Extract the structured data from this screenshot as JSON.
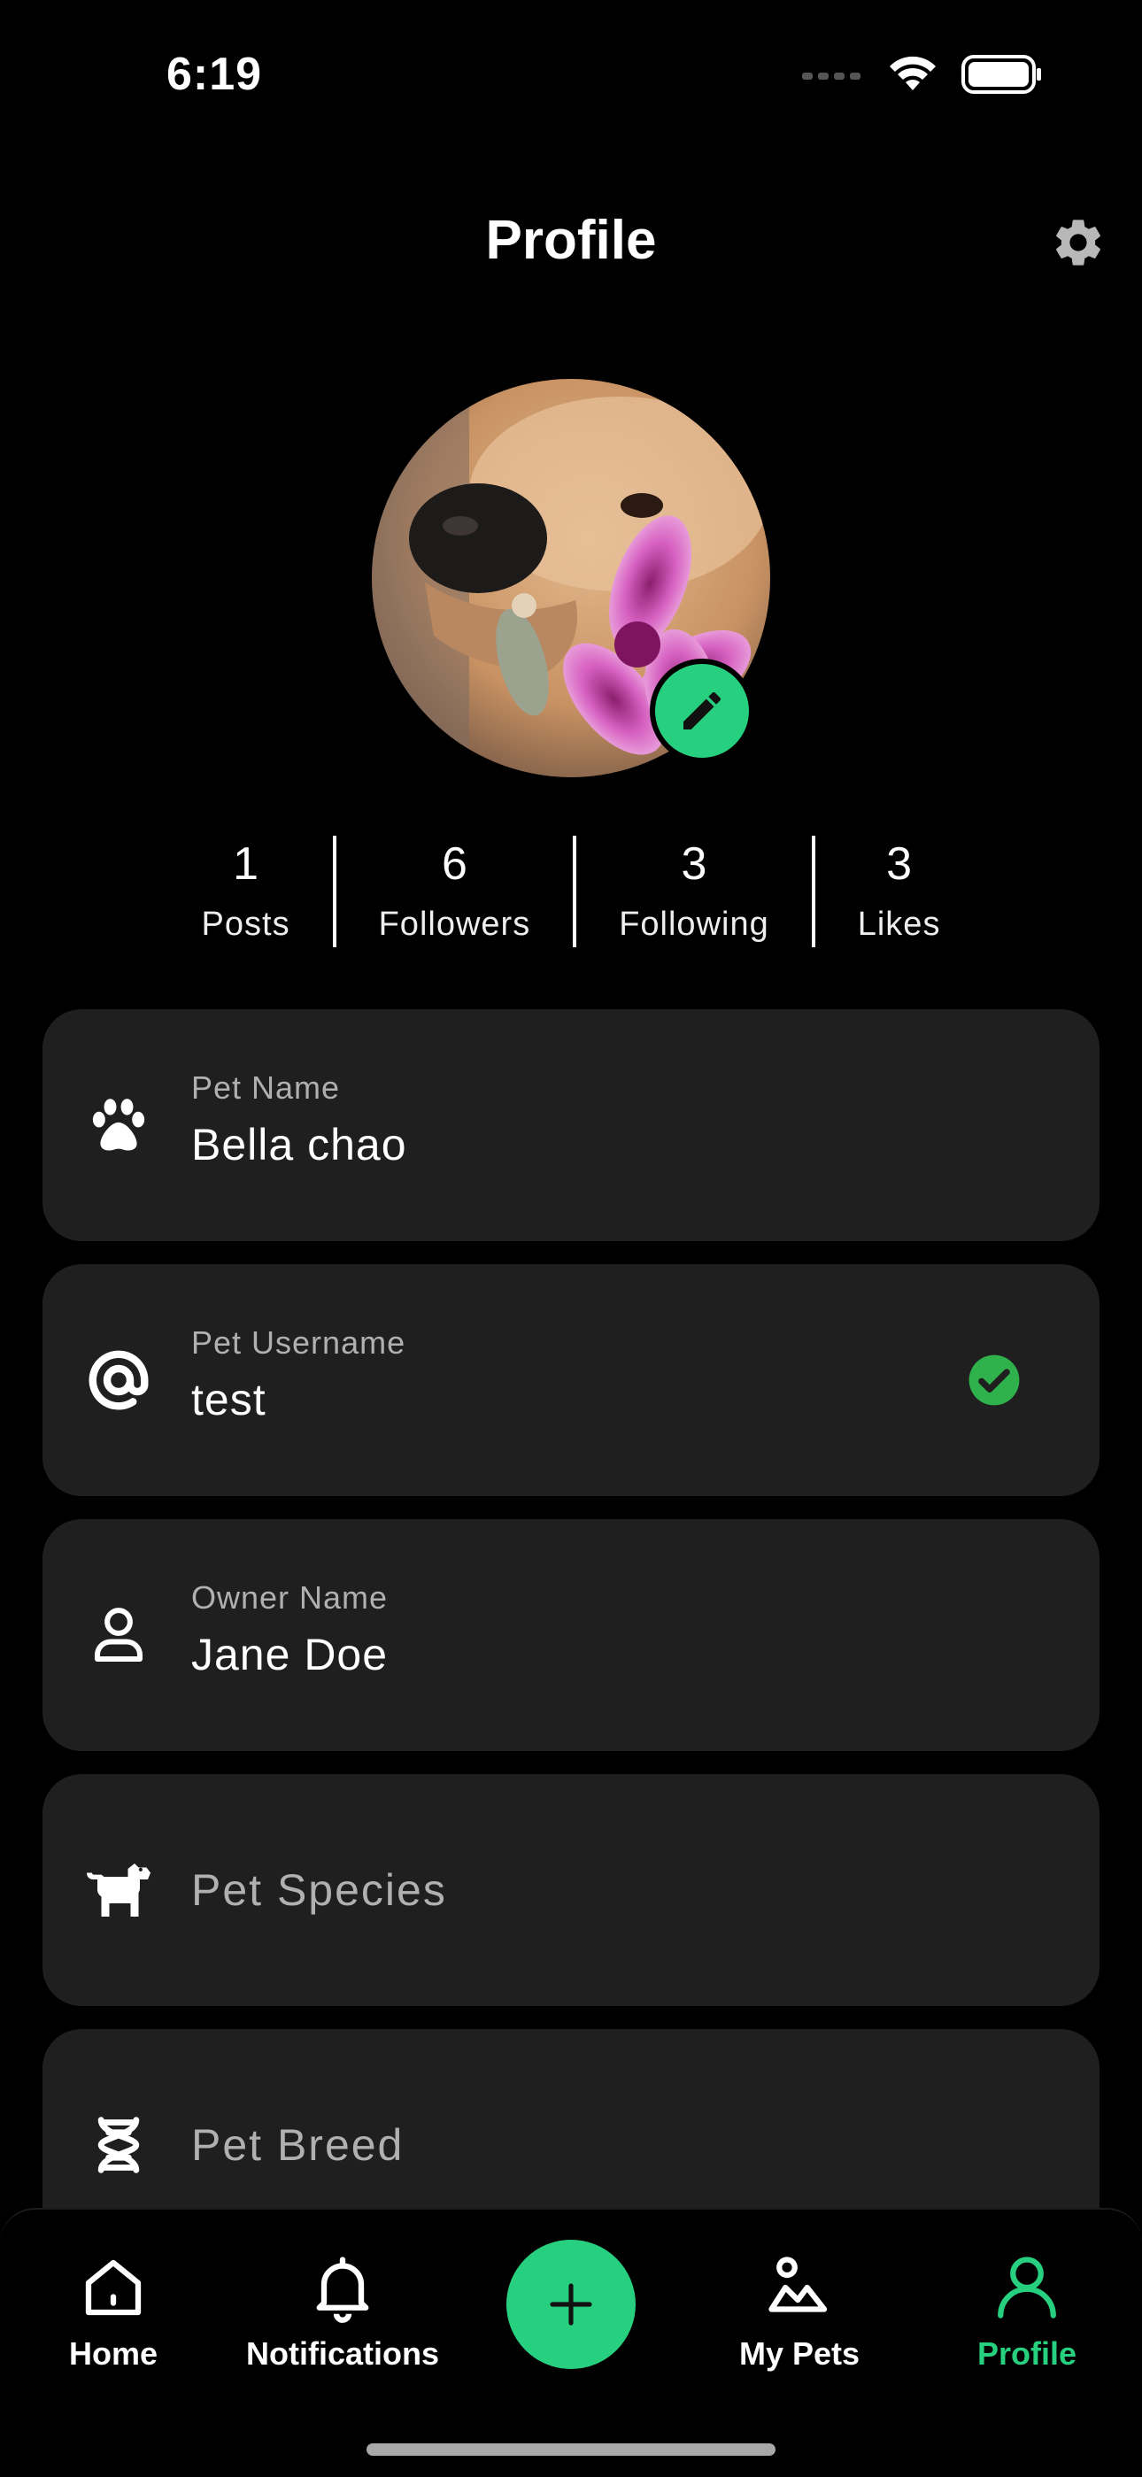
{
  "status_bar": {
    "time": "6:19"
  },
  "header": {
    "title": "Profile"
  },
  "stats": [
    {
      "value": "1",
      "label": "Posts"
    },
    {
      "value": "6",
      "label": "Followers"
    },
    {
      "value": "3",
      "label": "Following"
    },
    {
      "value": "3",
      "label": "Likes"
    }
  ],
  "fields": {
    "pet_name": {
      "label": "Pet Name",
      "value": "Bella chao"
    },
    "pet_username": {
      "label": "Pet Username",
      "value": "test"
    },
    "owner_name": {
      "label": "Owner Name",
      "value": "Jane Doe"
    },
    "pet_species": {
      "placeholder": "Pet Species"
    },
    "pet_breed": {
      "placeholder": "Pet Breed"
    }
  },
  "nav": {
    "home": "Home",
    "notifications": "Notifications",
    "my_pets": "My Pets",
    "profile": "Profile"
  },
  "colors": {
    "accent": "#27d07f",
    "card": "#1f1f1f",
    "background": "#000000",
    "check": "#2fb24c"
  },
  "icons": {
    "settings": "gear-icon",
    "edit": "pencil-icon",
    "pet_name": "paw-icon",
    "pet_username": "at-icon",
    "owner_name": "person-icon",
    "pet_species": "dog-icon",
    "pet_breed": "dna-icon",
    "verified": "check-circle-icon"
  }
}
